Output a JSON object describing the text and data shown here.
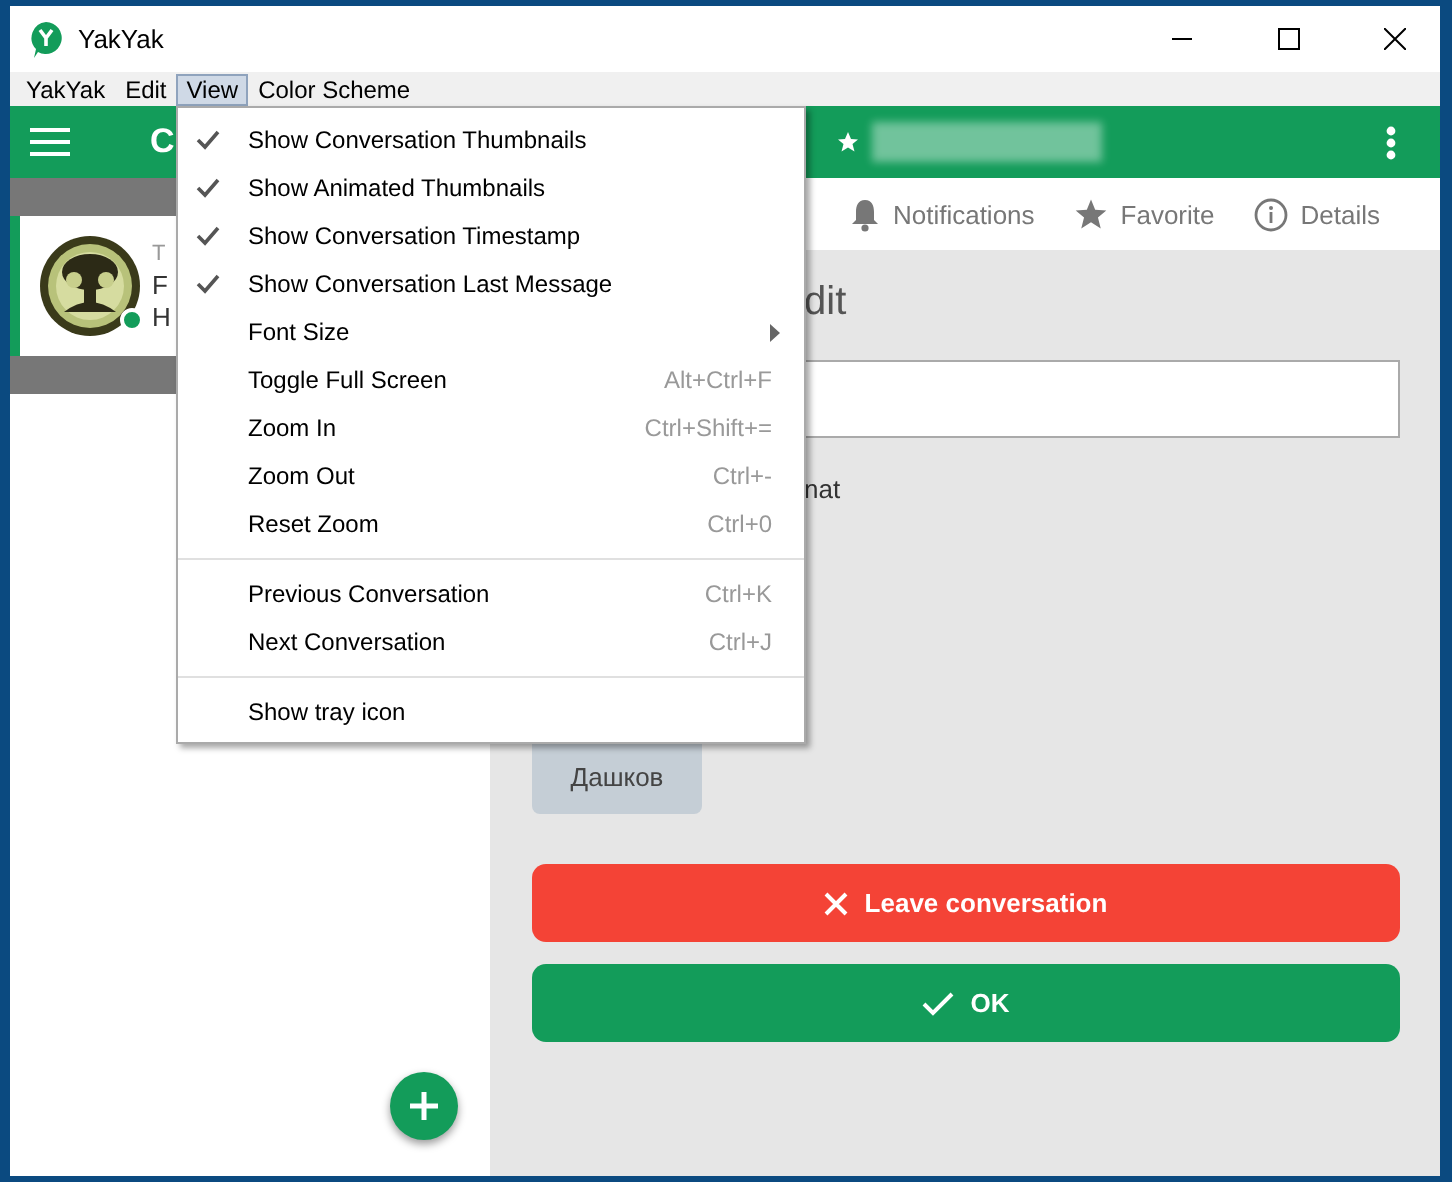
{
  "window": {
    "title": "YakYak"
  },
  "menu_bar": [
    {
      "label": "YakYak",
      "selected": false
    },
    {
      "label": "Edit",
      "selected": false
    },
    {
      "label": "View",
      "selected": true
    },
    {
      "label": "Color Scheme",
      "selected": false
    }
  ],
  "view_menu": [
    {
      "kind": "check",
      "label": "Show Conversation Thumbnails",
      "checked": true
    },
    {
      "kind": "check",
      "label": "Show Animated Thumbnails",
      "checked": true
    },
    {
      "kind": "check",
      "label": "Show Conversation Timestamp",
      "checked": true
    },
    {
      "kind": "check",
      "label": "Show Conversation Last Message",
      "checked": true
    },
    {
      "kind": "submenu",
      "label": "Font Size"
    },
    {
      "kind": "command",
      "label": "Toggle Full Screen",
      "shortcut": "Alt+Ctrl+F"
    },
    {
      "kind": "command",
      "label": "Zoom In",
      "shortcut": "Ctrl+Shift+="
    },
    {
      "kind": "command",
      "label": "Zoom Out",
      "shortcut": "Ctrl+-"
    },
    {
      "kind": "command",
      "label": "Reset Zoom",
      "shortcut": "Ctrl+0"
    },
    {
      "kind": "separator"
    },
    {
      "kind": "command",
      "label": "Previous Conversation",
      "shortcut": "Ctrl+K"
    },
    {
      "kind": "command",
      "label": "Next Conversation",
      "shortcut": "Ctrl+J"
    },
    {
      "kind": "separator"
    },
    {
      "kind": "command",
      "label": "Show tray icon"
    }
  ],
  "sidebar": {
    "header_title": "C",
    "conversation": {
      "online": true,
      "lines": [
        "T",
        "F",
        "H"
      ]
    }
  },
  "conversation": {
    "tabs": [
      "Notifications",
      "Favorite",
      "Details"
    ],
    "heading": "dit",
    "option_text": "nat",
    "participant": "Дашков",
    "buttons": [
      {
        "kind": "danger",
        "label": "Leave conversation"
      },
      {
        "kind": "confirm",
        "label": "OK"
      }
    ]
  }
}
